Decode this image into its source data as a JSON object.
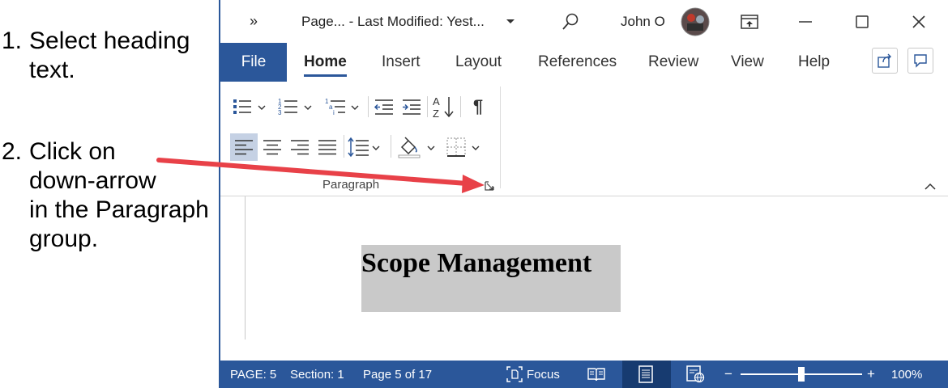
{
  "instructions": [
    {
      "number": "1.",
      "text": "Select heading\ntext."
    },
    {
      "number": "2.",
      "text": "Click on\ndown-arrow\nin the Paragraph\ngroup."
    }
  ],
  "titlebar": {
    "overflow_label": "»",
    "doc_title": "Page...  -  Last Modified: Yest...",
    "user_name": "John O",
    "icons": [
      "chevron-down-icon",
      "search-icon",
      "avatar",
      "ribbon-display-icon",
      "minimize-icon",
      "maximize-icon",
      "close-icon"
    ]
  },
  "menu": {
    "file": "File",
    "tabs": [
      "Home",
      "Insert",
      "Layout",
      "References",
      "Review",
      "View",
      "Help"
    ],
    "active_tab": "Home"
  },
  "ribbon": {
    "group_label": "Paragraph",
    "pilcrow": "¶"
  },
  "document": {
    "heading": "Scope Management"
  },
  "status": {
    "page": "PAGE: 5",
    "section": "Section: 1",
    "page_of": "Page 5 of 17",
    "focus": "Focus",
    "zoom_minus": "−",
    "zoom_plus": "+",
    "zoom": "100%",
    "zoom_percent": 100
  },
  "colors": {
    "word_blue": "#2b579a",
    "annotation_red": "#e84148",
    "selection_gray": "#c9c9c9",
    "selected_button": "#c5d1e4"
  }
}
